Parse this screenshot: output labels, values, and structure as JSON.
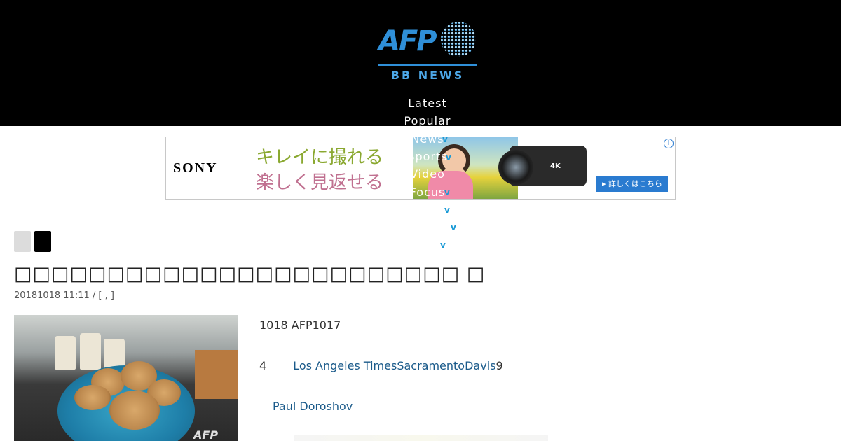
{
  "header": {
    "logo": {
      "brand": "AFP",
      "subtitle": "BB NEWS"
    },
    "nav": [
      {
        "label": "Latest"
      },
      {
        "label": "Popular"
      },
      {
        "label": "News"
      },
      {
        "label": "Sports"
      },
      {
        "label": "Video"
      },
      {
        "label": "Focus"
      }
    ],
    "chevron_glyph": "v"
  },
  "ad": {
    "brand": "SONY",
    "line1": "キレイに撮れる",
    "line2": "楽しく見返せる",
    "camera_badge": "4K",
    "cta": "▸ 詳しくはこちら",
    "info": "i"
  },
  "article": {
    "title": "□□□□□□□□□□□□□□□□□□□□□□□□ □",
    "meta": "20181018 11:11  /                    [ , ]",
    "photo_watermark": "AFP",
    "paragraphs": [
      {
        "plain": "1018 AFP1017"
      },
      {
        "plain": "4",
        "link": "Los Angeles TimesSacramentoDavis",
        "tail": "9"
      },
      {
        "link": "Paul Doroshov"
      }
    ]
  },
  "colors": {
    "header_bg": "#000000",
    "accent_blue": "#2f8fd8",
    "link": "#1a5a8a"
  }
}
